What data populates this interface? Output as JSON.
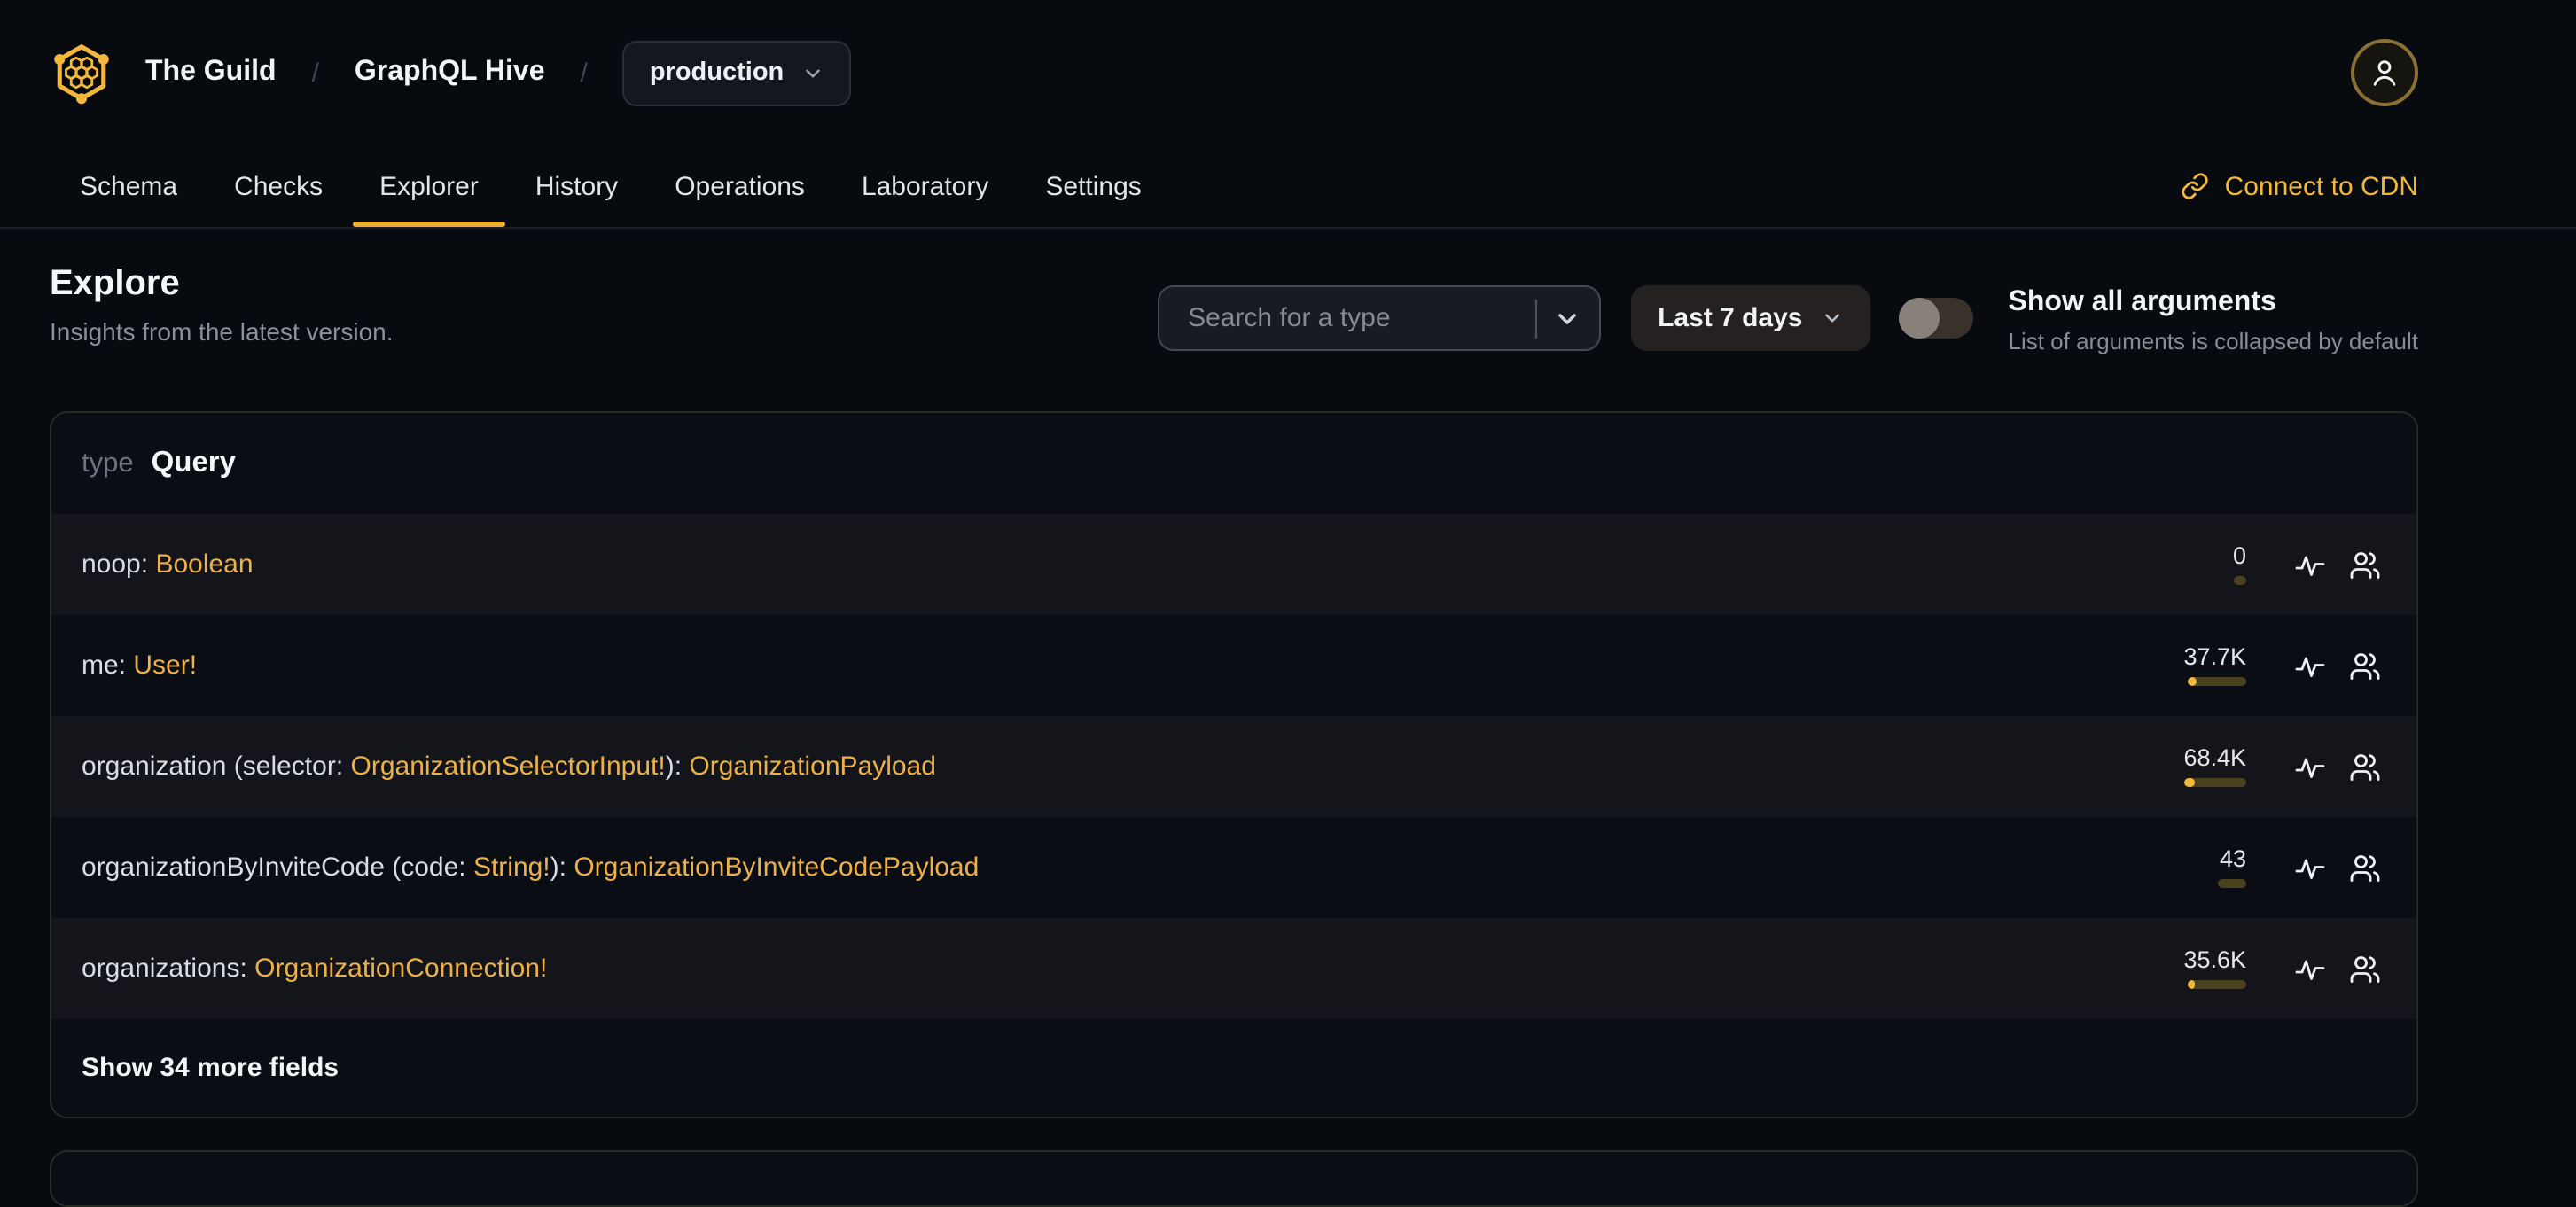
{
  "brand": {
    "org": "The Guild",
    "project": "GraphQL Hive",
    "target": "production",
    "separator": "/"
  },
  "nav": {
    "tabs": [
      "Schema",
      "Checks",
      "Explorer",
      "History",
      "Operations",
      "Laboratory",
      "Settings"
    ],
    "active_tab": "Explorer",
    "cdn_link": "Connect to CDN"
  },
  "page": {
    "title": "Explore",
    "subtitle": "Insights from the latest version."
  },
  "toolbar": {
    "search_placeholder": "Search for a type",
    "period": "Last 7 days",
    "toggle_label": "Show all arguments",
    "toggle_note": "List of arguments is collapsed by default",
    "toggle_state": "off"
  },
  "type_card": {
    "kind_label": "type",
    "type_name": "Query",
    "fields": [
      {
        "segments": [
          {
            "t": "noop: ",
            "k": "plain"
          },
          {
            "t": "Boolean",
            "k": "type"
          }
        ],
        "requests": "0",
        "bar": {
          "track": 7,
          "fill": 0
        },
        "striped": true
      },
      {
        "segments": [
          {
            "t": "me: ",
            "k": "plain"
          },
          {
            "t": "User!",
            "k": "type"
          }
        ],
        "requests": "37.7K",
        "bar": {
          "track": 33,
          "fill": 5
        },
        "striped": false
      },
      {
        "segments": [
          {
            "t": "organization (selector: ",
            "k": "plain"
          },
          {
            "t": "OrganizationSelectorInput!",
            "k": "type"
          },
          {
            "t": "): ",
            "k": "plain"
          },
          {
            "t": "OrganizationPayload",
            "k": "type"
          }
        ],
        "requests": "68.4K",
        "bar": {
          "track": 35,
          "fill": 6
        },
        "striped": true
      },
      {
        "segments": [
          {
            "t": "organizationByInviteCode (code: ",
            "k": "plain"
          },
          {
            "t": "String!",
            "k": "type"
          },
          {
            "t": "): ",
            "k": "plain"
          },
          {
            "t": "OrganizationByInviteCodePayload",
            "k": "type"
          }
        ],
        "requests": "43",
        "bar": {
          "track": 16,
          "fill": 0
        },
        "striped": false
      },
      {
        "segments": [
          {
            "t": "organizations: ",
            "k": "plain"
          },
          {
            "t": "OrganizationConnection!",
            "k": "type"
          }
        ],
        "requests": "35.6K",
        "bar": {
          "track": 33,
          "fill": 4
        },
        "striped": true
      }
    ],
    "show_more": "Show 34 more fields"
  },
  "colors": {
    "accent": "#f3b83b",
    "type_link": "#edb14a",
    "page_bg": "#070a0f",
    "card_bg": "#0a0d14",
    "stripe_bg": "#14151a",
    "bar_track": "#4a421e"
  }
}
